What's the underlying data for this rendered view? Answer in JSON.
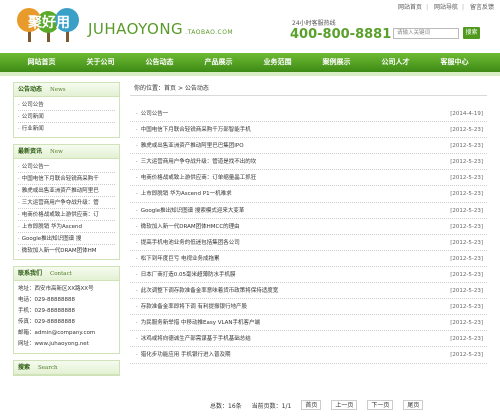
{
  "top_links": [
    "网站首页",
    "网站导航",
    "留言反馈"
  ],
  "logo": {
    "cn": "聚好用",
    "text": "JUHAOYONG",
    "suffix": ".TAOBAO.COM"
  },
  "hotline": {
    "label": "24小时客服热线",
    "number": "400-800-8881"
  },
  "search": {
    "placeholder": "请输入关键词",
    "button": "搜索"
  },
  "nav": [
    "网站首页",
    "关于公司",
    "公告动态",
    "产品展示",
    "业务范围",
    "案例展示",
    "公司人才",
    "客服中心"
  ],
  "sidebar": {
    "announce": {
      "title": "公告动态",
      "en": "News",
      "items": [
        "公司公告",
        "公司新闻",
        "行业新闻"
      ]
    },
    "latest": {
      "title": "最新资讯",
      "en": "New",
      "items": [
        "公司公告一",
        "中国电信下月联合轻锐商采购千",
        "雅虎或出售亚洲资产推动阿里巴",
        "三大运营商用户争夺战升级：管",
        "电商价格战或致上游供应商：订",
        "上市即脱销 华为Ascend",
        "Google推出知识图谱 搜",
        "微软加入新一代DRAM团体HM"
      ]
    },
    "contact": {
      "title": "联系我们",
      "en": "Contact",
      "lines": [
        "地址：西安市高新区XX路XX号",
        "电话：029-88888888",
        "手机：029-88888888",
        "传真：029-88888888",
        "邮箱：admin@company.com",
        "网址：www.juhaoyong.net"
      ]
    },
    "search_box": {
      "title": "搜索",
      "en": "Search"
    }
  },
  "main": {
    "crumb_prefix": "你的位置：",
    "crumb_home": "首页",
    "crumb_current": "公告动态",
    "articles": [
      {
        "title": "公司公告一",
        "date": "[2014-4-19]"
      },
      {
        "title": "中国电信下月联合轻锐商采购千万部智能手机",
        "date": "[2012-5-23]"
      },
      {
        "title": "雅虎或出售亚洲资产推动阿里巴巴集团IPO",
        "date": "[2012-5-23]"
      },
      {
        "title": "三大运营商用户争夺战升级：管道是找不出的坎",
        "date": "[2012-5-23]"
      },
      {
        "title": "电商价格战或致上游供应商：订单缩量晶工抓狂",
        "date": "[2012-5-23]"
      },
      {
        "title": "上市即脱销 华为Ascend P1一机难求",
        "date": "[2012-5-23]"
      },
      {
        "title": "Google推出知识图谱 搜索模式迎来大变革",
        "date": "[2012-5-23]"
      },
      {
        "title": "微软加入新一代DRAM团体HMCC的理由",
        "date": "[2012-5-23]"
      },
      {
        "title": "提高手机电池业务的低迷包括集团各公司",
        "date": "[2012-5-23]"
      },
      {
        "title": "松下到年度巨亏 电视业务成拖累",
        "date": "[2012-5-23]"
      },
      {
        "title": "日本厂商打造0.05毫米超薄防水手机膜",
        "date": "[2012-5-23]"
      },
      {
        "title": "此次调整下调存款准备金率意味着货币政策将保持适度宽",
        "date": "[2012-5-23]"
      },
      {
        "title": "存款准备金率即将下调 有利提振银行地产股",
        "date": "[2012-5-23]"
      },
      {
        "title": "为民服务新举措 中移动推Easy VLAN手机客户端",
        "date": "[2012-5-23]"
      },
      {
        "title": "冰鸡或将向德诚生产部需谋基于手机基础总结",
        "date": "[2012-5-23]"
      },
      {
        "title": "猎化步功能应用 手机银行进入普及期",
        "date": "[2012-5-23]"
      }
    ],
    "pager": {
      "total": "总数：16条",
      "page": "当前页数：1/1",
      "first": "首页",
      "prev": "上一页",
      "next": "下一页",
      "last": "尾页"
    }
  },
  "colors": {
    "brand_green": "#4f9a1c",
    "nav_top": "#6fbb34",
    "nav_bottom": "#3d8a16"
  }
}
